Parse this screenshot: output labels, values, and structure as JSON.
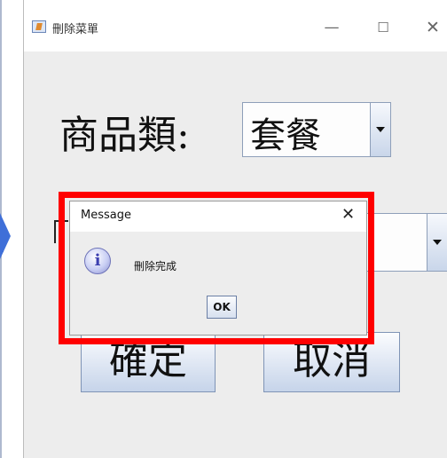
{
  "window": {
    "title": "刪除菜單",
    "controls": {
      "minimize": "—",
      "maximize": "☐",
      "close": "✕"
    }
  },
  "form": {
    "category_label": "商品類:",
    "category_value": "套餐",
    "confirm_label": "確定",
    "cancel_label": "取消"
  },
  "dialog": {
    "title": "Message",
    "close": "✕",
    "message": "刪除完成",
    "ok_label": "OK",
    "icon": "info-icon"
  },
  "colors": {
    "highlight": "#ff0000",
    "arrow": "#3f6fd8"
  }
}
